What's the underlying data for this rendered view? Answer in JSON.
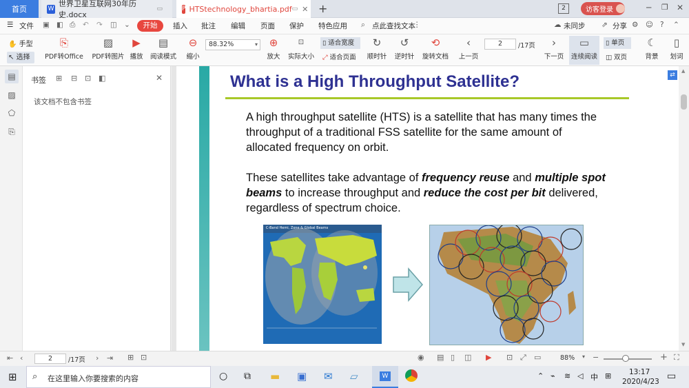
{
  "tabs": {
    "home": "首页",
    "doc": "世界卫星互联网30年历史.docx",
    "pdf": "HTStechnology_bhartia.pdf",
    "add": "+",
    "badge": "2",
    "login": "访客登录"
  },
  "menu": {
    "file": "文件",
    "start": "开始",
    "items": [
      "插入",
      "批注",
      "编辑",
      "页面",
      "保护",
      "特色应用"
    ],
    "search": "点此查找文本",
    "sync": "未同步",
    "share": "分享"
  },
  "toolbar": {
    "hand": "手型",
    "select": "选择",
    "pdf_office": "PDF转Office",
    "pdf_image": "PDF转图片",
    "play": "播放",
    "read_mode": "阅读模式",
    "zoom_value": "88.32%",
    "zoom_out": "缩小",
    "zoom_in": "放大",
    "actual_size": "实际大小",
    "fit_width": "适合宽度",
    "fit_page": "适合页面",
    "rotate_cw": "顺时针",
    "rotate_ccw": "逆时针",
    "rotate_doc": "旋转文档",
    "prev_page": "上一页",
    "page_current": "2",
    "page_total": "/17页",
    "next_page": "下一页",
    "continuous": "连续阅读",
    "single": "单页",
    "double": "双页",
    "background": "背景",
    "underline": "划词"
  },
  "bookmarks": {
    "title": "书签",
    "empty": "该文档不包含书签"
  },
  "slide": {
    "title": "What is a High Throughput Satellite?",
    "p1": "A high throughput satellite (HTS) is a satellite that has many times the throughput of a traditional FSS satellite for the same amount of allocated frequency on orbit.",
    "p2_a": "These satellites take advantage of ",
    "p2_b": "frequency reuse",
    "p2_c": " and ",
    "p2_d": "multiple spot beams",
    "p2_e": " to increase throughput and ",
    "p2_f": "reduce the cost per bit",
    "p2_g": " delivered, regardless of spectrum choice.",
    "map_caption": "C-Band Hemi, Zone & Global Beams"
  },
  "statusbar": {
    "page_current": "2",
    "page_total": "/17页",
    "zoom": "88%"
  },
  "taskbar": {
    "search_placeholder": "在这里输入你要搜索的内容",
    "ime": "中",
    "time": "13:17",
    "date": "2020/4/23"
  },
  "colors": {
    "accent_blue": "#3b7de0",
    "start_red": "#e8473f",
    "slide_title": "#2e3192",
    "title_rule": "#a8c828",
    "left_bar_teal": "#29a9a5"
  }
}
